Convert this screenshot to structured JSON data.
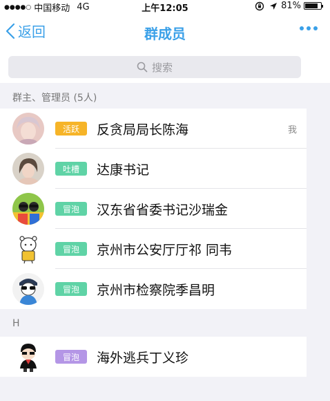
{
  "status_bar": {
    "signal_dots": "●●●●○",
    "carrier": "中国移动",
    "network": "4G",
    "time": "上午12:05",
    "battery": "81%",
    "battery_level": 0.81
  },
  "nav": {
    "back_label": "返回",
    "title": "群成员"
  },
  "search": {
    "placeholder": "搜索"
  },
  "sections": [
    {
      "header": "群主、管理员 (5人)"
    },
    {
      "header": "H"
    }
  ],
  "members": [
    {
      "badge": "活跃",
      "badge_color": "#f6b428",
      "name": "反贪局局长陈海",
      "me_label": "我"
    },
    {
      "badge": "吐槽",
      "badge_color": "#5fd3a6",
      "name": "达康书记"
    },
    {
      "badge": "冒泡",
      "badge_color": "#5fd3a6",
      "name": "汉东省省委书记沙瑞金"
    },
    {
      "badge": "冒泡",
      "badge_color": "#5fd3a6",
      "name": "京州市公安厅厅祁 同韦"
    },
    {
      "badge": "冒泡",
      "badge_color": "#5fd3a6",
      "name": "京州市检察院季昌明"
    },
    {
      "badge": "冒泡",
      "badge_color": "#b496e6",
      "name": "海外逃兵丁义珍"
    }
  ],
  "colors": {
    "accent": "#3aa0e8",
    "background": "#f2f2f7"
  }
}
